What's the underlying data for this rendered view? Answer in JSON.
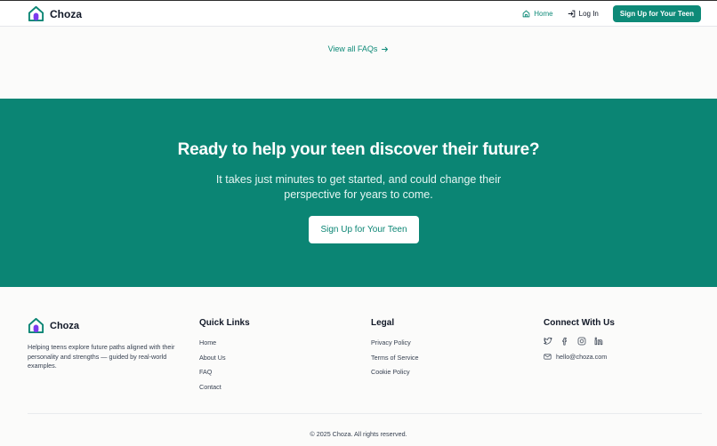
{
  "brand": {
    "name": "Choza"
  },
  "header": {
    "nav": {
      "home": "Home",
      "login": "Log In",
      "signup": "Sign Up for Your Teen"
    }
  },
  "faq": {
    "view_all": "View all FAQs"
  },
  "cta": {
    "title": "Ready to help your teen discover their future?",
    "subtitle_line1": "It takes just minutes to get started, and could change their",
    "subtitle_line2": "perspective for years to come.",
    "button": "Sign Up for Your Teen"
  },
  "footer": {
    "description": "Helping teens explore future paths aligned with their personality and strengths — guided by real-world examples.",
    "quick_links": {
      "title": "Quick Links",
      "items": [
        "Home",
        "About Us",
        "FAQ",
        "Contact"
      ]
    },
    "legal": {
      "title": "Legal",
      "items": [
        "Privacy Policy",
        "Terms of Service",
        "Cookie Policy"
      ]
    },
    "connect": {
      "title": "Connect With Us",
      "email": "hello@choza.com"
    },
    "copyright": "© 2025 Choza. All rights reserved."
  },
  "colors": {
    "brand_teal": "#0b8574",
    "logo_purple": "#7c3aed"
  },
  "icons": [
    "home-logo-icon",
    "home-icon",
    "login-icon",
    "arrow-right-icon",
    "twitter-icon",
    "facebook-icon",
    "instagram-icon",
    "linkedin-icon",
    "mail-icon"
  ]
}
